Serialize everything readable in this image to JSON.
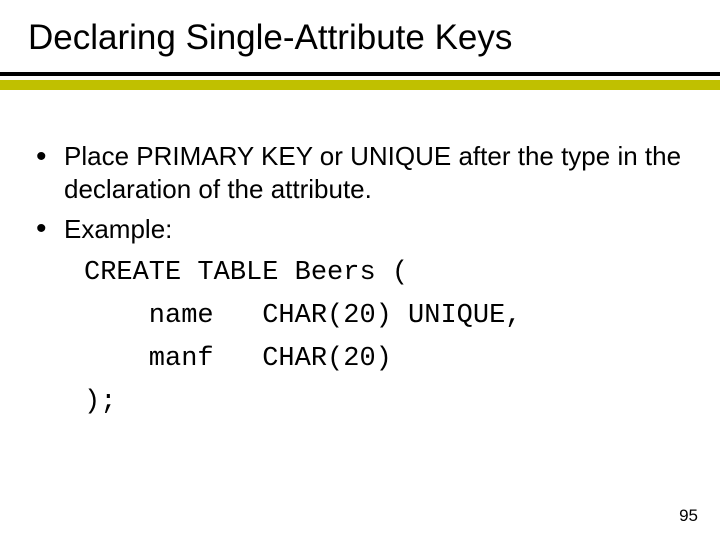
{
  "title": "Declaring Single-Attribute Keys",
  "bullets": {
    "b1": "Place PRIMARY KEY or UNIQUE after the type in the declaration of the attribute.",
    "b2": "Example:"
  },
  "code": {
    "l1": "CREATE TABLE Beers (",
    "l2": "    name   CHAR(20) UNIQUE,",
    "l3": "    manf   CHAR(20)",
    "l4": ");"
  },
  "page_number": "95"
}
